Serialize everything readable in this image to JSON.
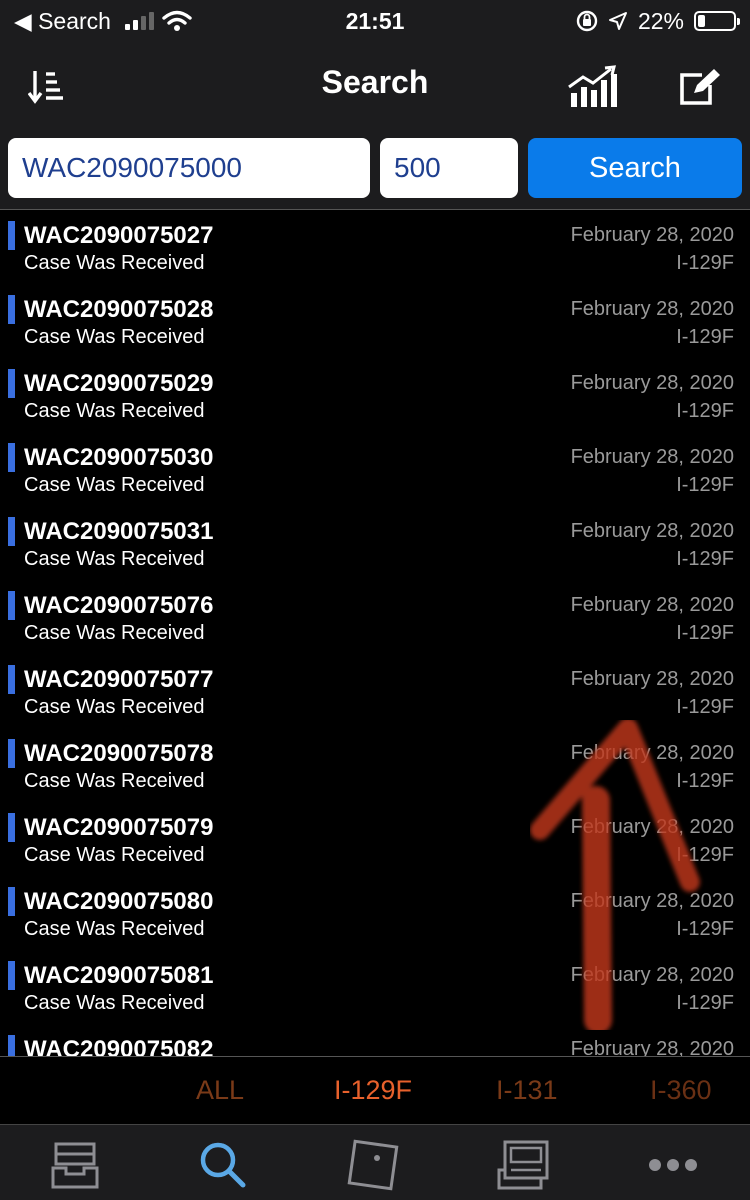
{
  "status_bar": {
    "back_label": "◀ Search",
    "time": "21:51",
    "battery_text": "22%",
    "battery_level": 0.22
  },
  "nav": {
    "title": "Search",
    "left_icon": "sort-icon",
    "right_icons": [
      "chart-icon",
      "edit-icon"
    ]
  },
  "search": {
    "case_value": "WAC2090075000",
    "count_value": "500",
    "button_label": "Search"
  },
  "results": [
    {
      "number": "WAC2090075027",
      "status": "Case Was Received",
      "date": "February 28, 2020",
      "form": "I-129F"
    },
    {
      "number": "WAC2090075028",
      "status": "Case Was Received",
      "date": "February 28, 2020",
      "form": "I-129F"
    },
    {
      "number": "WAC2090075029",
      "status": "Case Was Received",
      "date": "February 28, 2020",
      "form": "I-129F"
    },
    {
      "number": "WAC2090075030",
      "status": "Case Was Received",
      "date": "February 28, 2020",
      "form": "I-129F"
    },
    {
      "number": "WAC2090075031",
      "status": "Case Was Received",
      "date": "February 28, 2020",
      "form": "I-129F"
    },
    {
      "number": "WAC2090075076",
      "status": "Case Was Received",
      "date": "February 28, 2020",
      "form": "I-129F"
    },
    {
      "number": "WAC2090075077",
      "status": "Case Was Received",
      "date": "February 28, 2020",
      "form": "I-129F"
    },
    {
      "number": "WAC2090075078",
      "status": "Case Was Received",
      "date": "February 28, 2020",
      "form": "I-129F"
    },
    {
      "number": "WAC2090075079",
      "status": "Case Was Received",
      "date": "February 28, 2020",
      "form": "I-129F"
    },
    {
      "number": "WAC2090075080",
      "status": "Case Was Received",
      "date": "February 28, 2020",
      "form": "I-129F"
    },
    {
      "number": "WAC2090075081",
      "status": "Case Was Received",
      "date": "February 28, 2020",
      "form": "I-129F"
    },
    {
      "number": "WAC2090075082",
      "status": "",
      "date": "February 28, 2020",
      "form": ""
    }
  ],
  "filters": [
    {
      "label": "ALL",
      "active": false
    },
    {
      "label": "I-129F",
      "active": true
    },
    {
      "label": "I-131",
      "active": false
    },
    {
      "label": "I-360",
      "active": false
    }
  ],
  "tabs": [
    {
      "icon": "inbox-icon",
      "active": false
    },
    {
      "icon": "search-icon",
      "active": true
    },
    {
      "icon": "card-icon",
      "active": false
    },
    {
      "icon": "news-icon",
      "active": false
    },
    {
      "icon": "more-icon",
      "active": false
    }
  ],
  "colors": {
    "accent": "#0a7bea",
    "active_filter": "#e8612c",
    "inactive_filter": "#7a3a18",
    "row_marker": "#3a6fe0",
    "tab_active": "#5aa8e6",
    "tab_inactive": "#8e8e93",
    "annotation_arrow": "#c0391b"
  }
}
